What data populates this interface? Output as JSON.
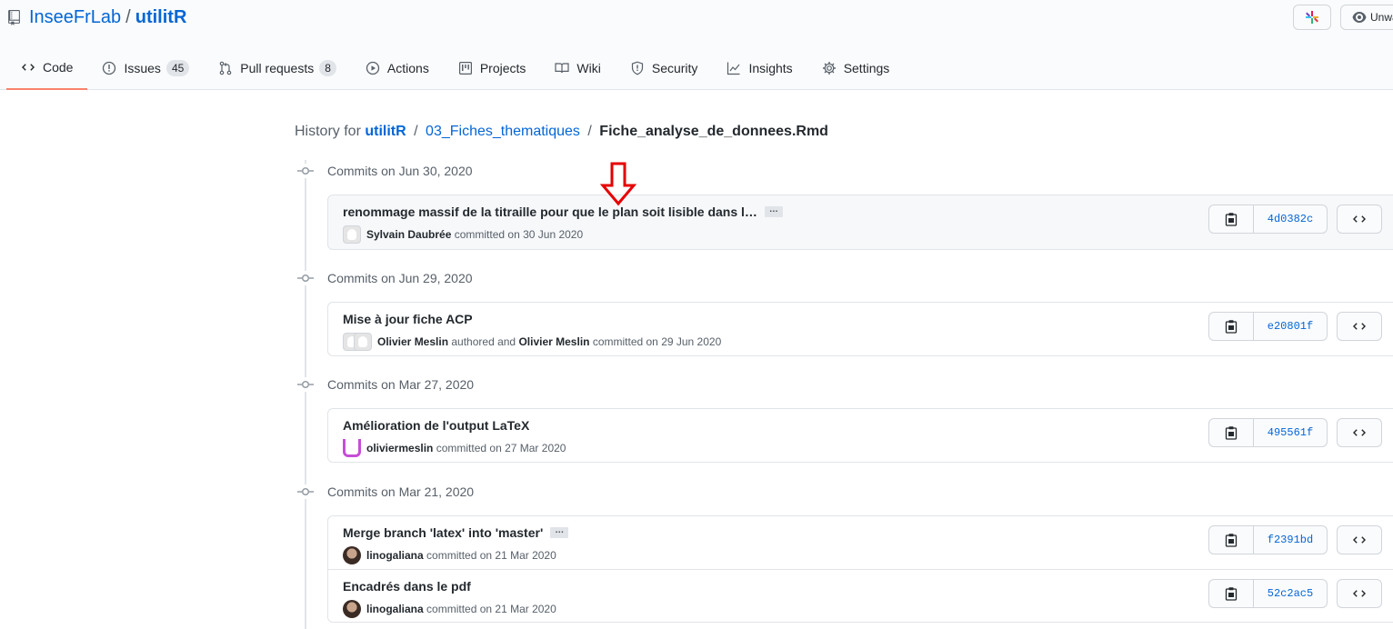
{
  "repo": {
    "owner": "InseeFrLab",
    "separator": "/",
    "name": "utilitR",
    "watch_label": "Unwatch"
  },
  "tabs": [
    {
      "label": "Code",
      "icon": "code-icon"
    },
    {
      "label": "Issues",
      "icon": "issue-opened-icon",
      "count": "45"
    },
    {
      "label": "Pull requests",
      "icon": "git-pull-request-icon",
      "count": "8"
    },
    {
      "label": "Actions",
      "icon": "play-icon"
    },
    {
      "label": "Projects",
      "icon": "project-icon"
    },
    {
      "label": "Wiki",
      "icon": "book-icon"
    },
    {
      "label": "Security",
      "icon": "shield-icon"
    },
    {
      "label": "Insights",
      "icon": "graph-icon"
    },
    {
      "label": "Settings",
      "icon": "gear-icon"
    }
  ],
  "breadcrumb": {
    "prefix": "History for",
    "repo": "utilitR",
    "sep": "/",
    "folder": "03_Fiches_thematiques",
    "file": "Fiche_analyse_de_donnees.Rmd"
  },
  "groups": [
    {
      "date": "Commits on Jun 30, 2020",
      "commits": [
        {
          "title": "renommage massif de la titraille pour que le plan soit lisible dans l…",
          "has_more": true,
          "author": "Sylvain Daubrée",
          "action": "committed on 30 Jun 2020",
          "sha": "4d0382c"
        }
      ]
    },
    {
      "date": "Commits on Jun 29, 2020",
      "commits": [
        {
          "title": "Mise à jour fiche ACP",
          "author": "Olivier Meslin",
          "authored_text": "authored and",
          "committer": "Olivier Meslin",
          "action": "committed on 29 Jun 2020",
          "sha": "e20801f"
        }
      ]
    },
    {
      "date": "Commits on Mar 27, 2020",
      "commits": [
        {
          "title": "Amélioration de l'output LaTeX",
          "author": "oliviermeslin",
          "action": "committed on 27 Mar 2020",
          "sha": "495561f"
        }
      ]
    },
    {
      "date": "Commits on Mar 21, 2020",
      "commits": [
        {
          "title": "Merge branch 'latex' into 'master'",
          "has_more": true,
          "author": "linogaliana",
          "action": "committed on 21 Mar 2020",
          "sha": "f2391bd"
        },
        {
          "title": "Encadrés dans le pdf",
          "author": "linogaliana",
          "action": "committed on 21 Mar 2020",
          "sha": "52c2ac5"
        }
      ]
    }
  ],
  "ellipsis": "…",
  "colors": {
    "link": "#0366d6",
    "tab_underline": "#f9826c",
    "annotation_arrow": "#e60000"
  }
}
